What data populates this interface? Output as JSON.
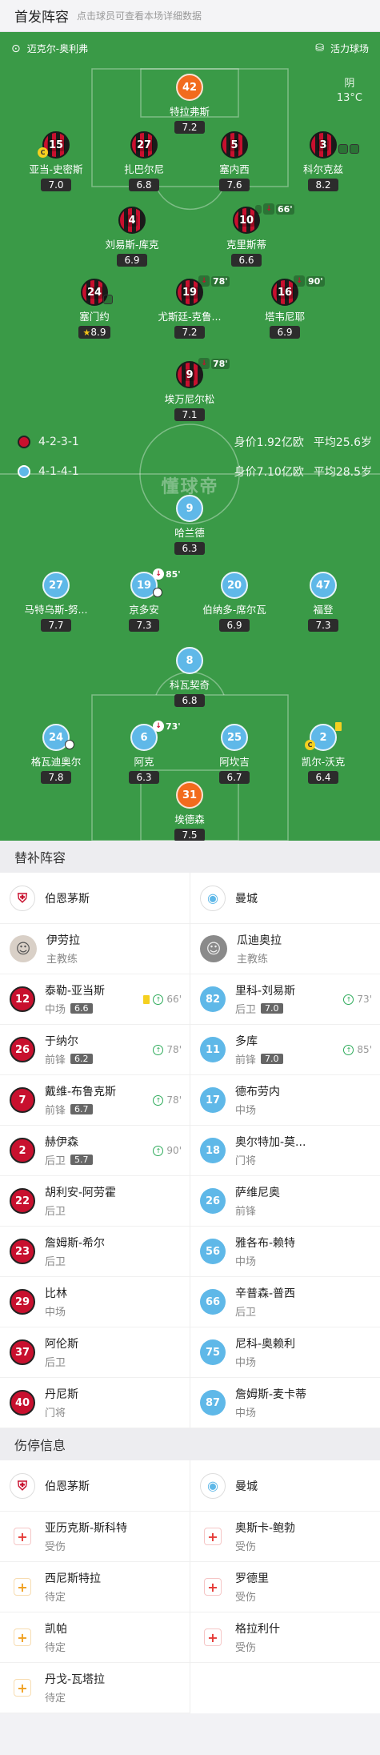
{
  "header": {
    "title": "首发阵容",
    "subtitle": "点击球员可查看本场详细数据"
  },
  "match": {
    "referee": "迈克尔-奥利弗",
    "stadium": "活力球场",
    "weather": "阴",
    "temperature": "13°C",
    "watermark": "懂球帝"
  },
  "home": {
    "name": "伯恩茅斯",
    "formation": "4-2-3-1",
    "value": "身价1.92亿欧",
    "age": "平均25.6岁",
    "players": [
      {
        "num": "42",
        "name": "特拉弗斯",
        "rating": "7.2",
        "gk": true
      },
      {
        "num": "15",
        "name": "亚当-史密斯",
        "rating": "7.0",
        "captain": "C"
      },
      {
        "num": "27",
        "name": "扎巴尔尼",
        "rating": "6.8"
      },
      {
        "num": "5",
        "name": "塞内西",
        "rating": "7.6"
      },
      {
        "num": "3",
        "name": "科尔克兹",
        "rating": "8.2"
      },
      {
        "num": "4",
        "name": "刘易斯-库克",
        "rating": "6.9"
      },
      {
        "num": "10",
        "name": "克里斯蒂",
        "rating": "6.6",
        "sub": "66'"
      },
      {
        "num": "24",
        "name": "塞门约",
        "rating": "8.9"
      },
      {
        "num": "19",
        "name": "尤斯廷-克鲁...",
        "rating": "7.2",
        "sub": "78'"
      },
      {
        "num": "16",
        "name": "塔韦尼耶",
        "rating": "6.9",
        "sub": "90'"
      },
      {
        "num": "9",
        "name": "埃万尼尔松",
        "rating": "7.1",
        "sub": "78'"
      }
    ]
  },
  "away": {
    "name": "曼城",
    "formation": "4-1-4-1",
    "value": "身价7.10亿欧",
    "age": "平均28.5岁",
    "players": [
      {
        "num": "9",
        "name": "哈兰德",
        "rating": "6.3"
      },
      {
        "num": "27",
        "name": "马特乌斯-努...",
        "rating": "7.7"
      },
      {
        "num": "19",
        "name": "京多安",
        "rating": "7.3",
        "sub": "85'"
      },
      {
        "num": "20",
        "name": "伯纳多-席尔瓦",
        "rating": "6.9"
      },
      {
        "num": "47",
        "name": "福登",
        "rating": "7.3"
      },
      {
        "num": "8",
        "name": "科瓦契奇",
        "rating": "6.8"
      },
      {
        "num": "24",
        "name": "格瓦迪奥尔",
        "rating": "7.8"
      },
      {
        "num": "6",
        "name": "阿克",
        "rating": "6.3",
        "sub": "73'"
      },
      {
        "num": "25",
        "name": "阿坎吉",
        "rating": "6.7"
      },
      {
        "num": "2",
        "name": "凯尔-沃克",
        "rating": "6.4",
        "captain": "C"
      },
      {
        "num": "31",
        "name": "埃德森",
        "rating": "7.5",
        "gk": true
      }
    ]
  },
  "subs_section": {
    "title": "替补阵容"
  },
  "subs_home": [
    {
      "name": "伊劳拉",
      "pos": "主教练",
      "coach": true
    },
    {
      "num": "12",
      "name": "泰勒-亚当斯",
      "pos": "中场",
      "rating": "6.6",
      "time": "66'",
      "ycard": true
    },
    {
      "num": "26",
      "name": "于纳尔",
      "pos": "前锋",
      "rating": "6.2",
      "time": "78'"
    },
    {
      "num": "7",
      "name": "戴维-布鲁克斯",
      "pos": "前锋",
      "rating": "6.7",
      "time": "78'"
    },
    {
      "num": "2",
      "name": "赫伊森",
      "pos": "后卫",
      "rating": "5.7",
      "time": "90'"
    },
    {
      "num": "22",
      "name": "胡利安-阿劳霍",
      "pos": "后卫"
    },
    {
      "num": "23",
      "name": "詹姆斯-希尔",
      "pos": "后卫"
    },
    {
      "num": "29",
      "name": "比林",
      "pos": "中场"
    },
    {
      "num": "37",
      "name": "阿伦斯",
      "pos": "后卫"
    },
    {
      "num": "40",
      "name": "丹尼斯",
      "pos": "门将"
    }
  ],
  "subs_away": [
    {
      "name": "瓜迪奥拉",
      "pos": "主教练",
      "coach": true
    },
    {
      "num": "82",
      "name": "里科-刘易斯",
      "pos": "后卫",
      "rating": "7.0",
      "time": "73'"
    },
    {
      "num": "11",
      "name": "多库",
      "pos": "前锋",
      "rating": "7.0",
      "time": "85'"
    },
    {
      "num": "17",
      "name": "德布劳内",
      "pos": "中场"
    },
    {
      "num": "18",
      "name": "奥尔特加-莫...",
      "pos": "门将"
    },
    {
      "num": "26",
      "name": "萨维尼奥",
      "pos": "前锋"
    },
    {
      "num": "56",
      "name": "雅各布-赖特",
      "pos": "中场"
    },
    {
      "num": "66",
      "name": "辛普森-普西",
      "pos": "后卫"
    },
    {
      "num": "75",
      "name": "尼科-奥赖利",
      "pos": "中场"
    },
    {
      "num": "87",
      "name": "詹姆斯-麦卡蒂",
      "pos": "中场"
    }
  ],
  "injury_section": {
    "title": "伤停信息"
  },
  "injury_home": [
    {
      "name": "亚历克斯-斯科特",
      "status": "受伤",
      "type": "injured"
    },
    {
      "name": "西尼斯特拉",
      "status": "待定",
      "type": "doubt"
    },
    {
      "name": "凯帕",
      "status": "待定",
      "type": "doubt"
    },
    {
      "name": "丹戈-瓦塔拉",
      "status": "待定",
      "type": "doubt"
    }
  ],
  "injury_away": [
    {
      "name": "奥斯卡-鲍勃",
      "status": "受伤",
      "type": "injured"
    },
    {
      "name": "罗德里",
      "status": "受伤",
      "type": "injured"
    },
    {
      "name": "格拉利什",
      "status": "受伤",
      "type": "injured"
    }
  ],
  "colors": {
    "pitch": "#3a9a47",
    "home": "#c8102e",
    "away": "#5fb8e8",
    "gk": "#f26b1d"
  }
}
